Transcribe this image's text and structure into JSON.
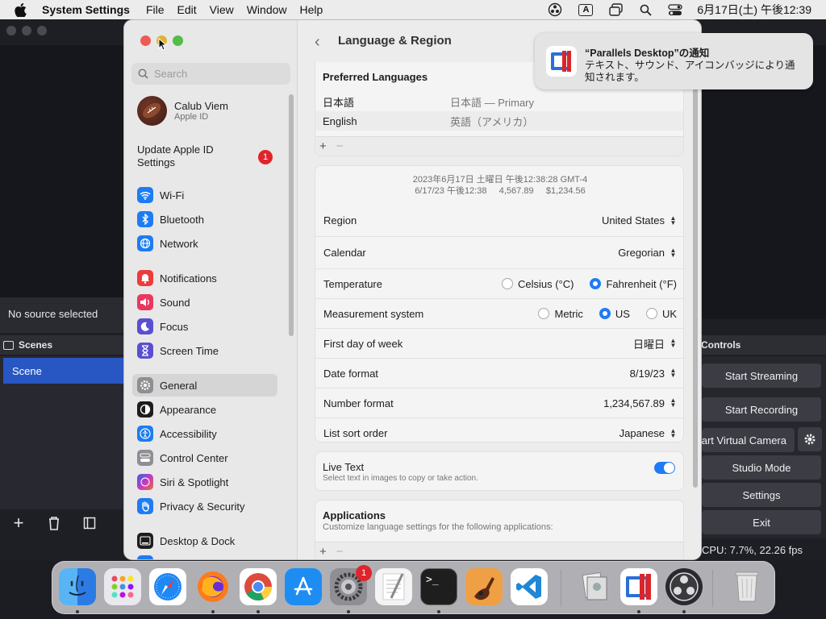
{
  "menubar": {
    "app_name": "System Settings",
    "menus": [
      "File",
      "Edit",
      "View",
      "Window",
      "Help"
    ],
    "a_label": "A",
    "clock": "6月17日(土) 午後12:39"
  },
  "obs": {
    "no_source": "No source selected",
    "scenes_header": "Scenes",
    "scene_name": "Scene",
    "controls_header": "Controls",
    "start_streaming": "Start Streaming",
    "start_recording": "Start Recording",
    "start_virtual_camera": "Start Virtual Camera",
    "studio_mode": "Studio Mode",
    "settings": "Settings",
    "exit": "Exit",
    "status": "CPU: 7.7%, 22.26 fps"
  },
  "sidebar": {
    "search_placeholder": "Search",
    "profile_name": "Calub Viem",
    "profile_sub": "Apple ID",
    "update_label": "Update Apple ID Settings",
    "update_badge": "1",
    "items": [
      {
        "label": "Wi-Fi",
        "icon": "wifi-icon",
        "color": "#1e7cf2"
      },
      {
        "label": "Bluetooth",
        "icon": "bluetooth-icon",
        "color": "#1e7cf2"
      },
      {
        "label": "Network",
        "icon": "globe-icon",
        "color": "#1e7cf2"
      },
      {
        "label": "Notifications",
        "icon": "bell-icon",
        "color": "#ee3b3b"
      },
      {
        "label": "Sound",
        "icon": "speaker-icon",
        "color": "#e8385f"
      },
      {
        "label": "Focus",
        "icon": "moon-icon",
        "color": "#5a4fcf"
      },
      {
        "label": "Screen Time",
        "icon": "hourglass-icon",
        "color": "#5a4fcf"
      },
      {
        "label": "General",
        "icon": "gear-icon",
        "color": "#8e8e93"
      },
      {
        "label": "Appearance",
        "icon": "appearance-icon",
        "color": "#1d1d1f"
      },
      {
        "label": "Accessibility",
        "icon": "accessibility-icon",
        "color": "#1e7cf2"
      },
      {
        "label": "Control Center",
        "icon": "control-center-icon",
        "color": "#8e8e93"
      },
      {
        "label": "Siri & Spotlight",
        "icon": "siri-icon",
        "color": "#b33cc9"
      },
      {
        "label": "Privacy & Security",
        "icon": "hand-icon",
        "color": "#1e7cf2"
      },
      {
        "label": "Desktop & Dock",
        "icon": "dock-icon",
        "color": "#1d1d1f"
      }
    ]
  },
  "content": {
    "title": "Language & Region",
    "preferred_languages_header": "Preferred Languages",
    "languages": [
      {
        "name": "日本語",
        "detail": "日本語 — Primary"
      },
      {
        "name": "English",
        "detail": "英語（アメリカ）"
      }
    ],
    "plus": "+",
    "minus": "−",
    "preview_line1": "2023年6月17日 土曜日 午後12:38:28 GMT-4",
    "preview_line2": "6/17/23 午後12:38     4,567.89     $1,234.56",
    "region_label": "Region",
    "region_value": "United States",
    "calendar_label": "Calendar",
    "calendar_value": "Gregorian",
    "temperature_label": "Temperature",
    "temp_celsius": "Celsius (°C)",
    "temp_fahrenheit": "Fahrenheit (°F)",
    "measurement_label": "Measurement system",
    "measure_metric": "Metric",
    "measure_us": "US",
    "measure_uk": "UK",
    "first_day_label": "First day of week",
    "first_day_value": "日曜日",
    "date_format_label": "Date format",
    "date_format_value": "8/19/23",
    "number_format_label": "Number format",
    "number_format_value": "1,234,567.89",
    "list_sort_label": "List sort order",
    "list_sort_value": "Japanese",
    "live_text_label": "Live Text",
    "live_text_desc": "Select text in images to copy or take action.",
    "applications_header": "Applications",
    "applications_desc": "Customize language settings for the following applications:"
  },
  "notification": {
    "title": "“Parallels Desktop”の通知",
    "body": "テキスト、サウンド、アイコンバッジにより通知されます。"
  },
  "dock": {
    "items": [
      "finder-icon",
      "launchpad-icon",
      "safari-icon",
      "firefox-icon",
      "chrome-icon",
      "app-store-icon",
      "system-settings-icon",
      "textedit-icon",
      "terminal-icon",
      "garageband-icon",
      "vscode-icon",
      "preview-icon",
      "parallels-icon",
      "obs-icon",
      "trash-icon"
    ],
    "settings_badge": "1",
    "terminal_prompt": ">_"
  }
}
